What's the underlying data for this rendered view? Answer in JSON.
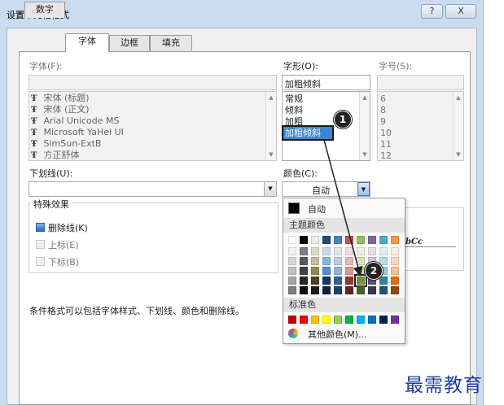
{
  "window": {
    "title": "设置单元格格式",
    "help_label": "?",
    "close_label": "X"
  },
  "tabs": [
    {
      "label": "数字"
    },
    {
      "label": "字体"
    },
    {
      "label": "边框"
    },
    {
      "label": "填充"
    }
  ],
  "font": {
    "label": "字体(F):",
    "items": [
      "宋体 (标题)",
      "宋体 (正文)",
      "Arial Unicode MS",
      "Microsoft YaHei UI",
      "SimSun-ExtB",
      "方正舒体"
    ]
  },
  "style": {
    "label": "字形(O):",
    "value": "加粗倾斜",
    "items": [
      "常规",
      "倾斜",
      "加粗",
      "加粗倾斜"
    ],
    "selected": "加粗倾斜"
  },
  "size": {
    "label": "字号(S):",
    "items": [
      "6",
      "8",
      "9",
      "10",
      "11",
      "12"
    ]
  },
  "underline": {
    "label": "下划线(U):"
  },
  "color": {
    "label": "颜色(C):",
    "value": "自动"
  },
  "effects": {
    "title": "特殊效果",
    "strikethrough": "删除线(K)",
    "superscript": "上标(E)",
    "subscript": "下标(B)"
  },
  "preview_text": "bCc",
  "note": "条件格式可以包括字体样式、下划线、颜色和删除线。",
  "color_popup": {
    "auto_label": "自动",
    "theme_header": "主题颜色",
    "standard_header": "标准色",
    "more_label": "其他颜色(M)...",
    "theme_top": [
      "#ffffff",
      "#000000",
      "#eeece1",
      "#1f497d",
      "#4f81bd",
      "#c0504d",
      "#9bbb59",
      "#8064a2",
      "#4bacc6",
      "#f79646"
    ],
    "theme_shades": [
      [
        "#f2f2f2",
        "#7f7f7f",
        "#ddd9c3",
        "#c6d9f0",
        "#dbe5f1",
        "#f2dcdb",
        "#ebf1dd",
        "#e5e0ec",
        "#dbeef3",
        "#fdeada"
      ],
      [
        "#d8d8d8",
        "#595959",
        "#c4bd97",
        "#8db3e2",
        "#b8cce4",
        "#e5b9b7",
        "#d7e3bc",
        "#ccc1d9",
        "#b7dde8",
        "#fbd5b5"
      ],
      [
        "#bfbfbf",
        "#3f3f3f",
        "#938953",
        "#548dd4",
        "#95b3d7",
        "#d99694",
        "#c3d69b",
        "#b2a2c7",
        "#92cddc",
        "#fac08f"
      ],
      [
        "#a5a5a5",
        "#262626",
        "#494429",
        "#17365d",
        "#366092",
        "#953734",
        "#76923c",
        "#5f497a",
        "#31859b",
        "#e36c09"
      ],
      [
        "#7f7f7f",
        "#0c0c0c",
        "#1d1b10",
        "#0f243e",
        "#244061",
        "#632423",
        "#4f6128",
        "#3f3151",
        "#205867",
        "#974806"
      ]
    ],
    "standard": [
      "#c00000",
      "#ff0000",
      "#ffc000",
      "#ffff00",
      "#92d050",
      "#00b050",
      "#00b0f0",
      "#0070c0",
      "#002060",
      "#7030a0"
    ],
    "selected_color": "#76923c"
  },
  "callouts": [
    "1",
    "2"
  ],
  "watermark": "最需教育"
}
